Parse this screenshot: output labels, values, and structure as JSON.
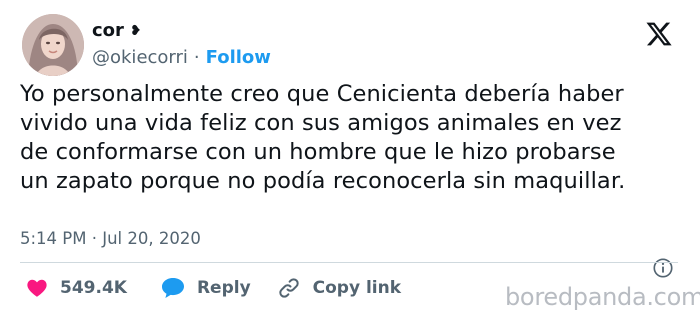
{
  "author": {
    "display_name": "cor",
    "name_icon": "heart-suit-icon",
    "name_icon_glyph": "❥",
    "handle": "@okiecorri",
    "separator": "·",
    "follow_label": "Follow"
  },
  "tweet": {
    "text": "Yo personalmente creo que Cenicienta debería haber\nvivido una vida feliz con sus amigos animales en vez\nde conformarse con un hombre que le hizo probarse\nun zapato porque no podía reconocerla sin maquillar.",
    "timestamp": "5:14 PM · Jul 20, 2020"
  },
  "actions": {
    "like_count": "549.4K",
    "reply_label": "Reply",
    "copy_link_label": "Copy link"
  },
  "watermark": "boredpanda.com",
  "colors": {
    "accent": "#1d9bf0",
    "like": "#f91880",
    "text": "#0f1419",
    "muted": "#536471"
  }
}
